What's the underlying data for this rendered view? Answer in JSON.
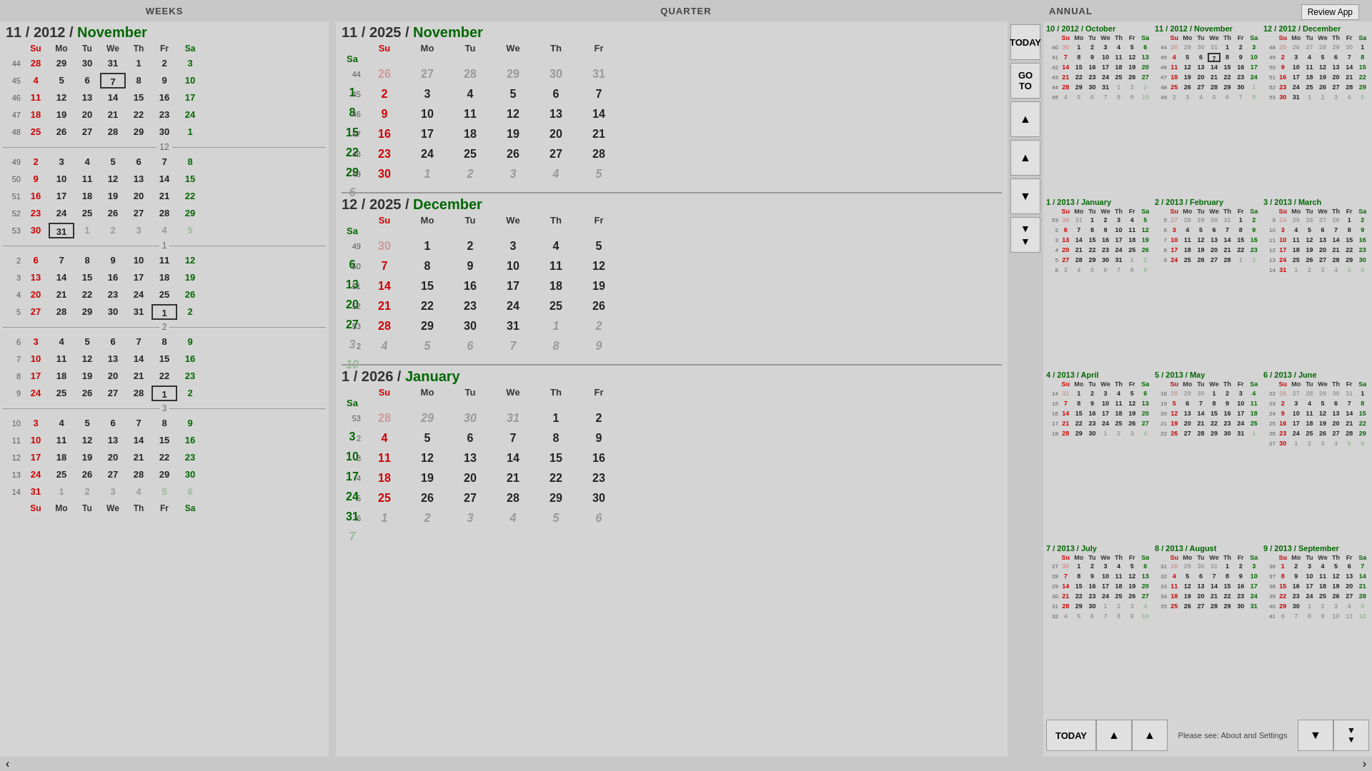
{
  "header": {
    "weeks_label": "WEEKS",
    "quarter_label": "QUARTER",
    "annual_label": "ANNUAL",
    "review_app": "Review App"
  },
  "weeks": {
    "title": "11 / 2012 / November",
    "day_headers": [
      "Su",
      "Mo",
      "Tu",
      "We",
      "Th",
      "Fr",
      "Sa"
    ],
    "today_btn": "TODAY",
    "goto_btn": "GO TO"
  },
  "quarter": {
    "today_btn": "TODAY",
    "goto_btn": "GO TO"
  },
  "annual": {
    "today_btn": "TODAY",
    "footer_text": "Please see: About and Settings"
  }
}
